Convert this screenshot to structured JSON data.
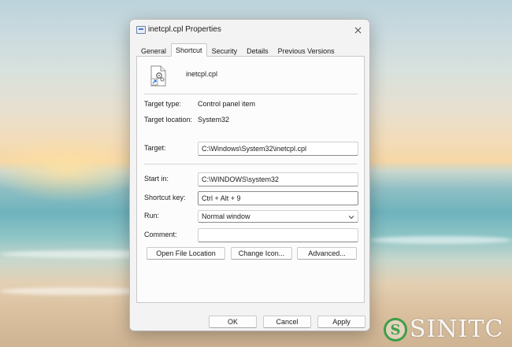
{
  "window": {
    "title": "inetcpl.cpl Properties"
  },
  "tabs": [
    {
      "label": "General"
    },
    {
      "label": "Shortcut"
    },
    {
      "label": "Security"
    },
    {
      "label": "Details"
    },
    {
      "label": "Previous Versions"
    }
  ],
  "active_tab": "Shortcut",
  "shortcut": {
    "file_name": "inetcpl.cpl",
    "target_type_label": "Target type:",
    "target_type_value": "Control panel item",
    "target_location_label": "Target location:",
    "target_location_value": "System32",
    "target_label": "Target:",
    "target_value": "C:\\Windows\\System32\\inetcpl.cpl",
    "start_in_label": "Start in:",
    "start_in_value": "C:\\WINDOWS\\system32",
    "shortcut_key_label": "Shortcut key:",
    "shortcut_key_value": "Ctrl + Alt + 9",
    "run_label": "Run:",
    "run_value": "Normal window",
    "comment_label": "Comment:",
    "comment_value": "",
    "open_file_location_label": "Open File Location",
    "change_icon_label": "Change Icon...",
    "advanced_label": "Advanced..."
  },
  "footer": {
    "ok_label": "OK",
    "cancel_label": "Cancel",
    "apply_label": "Apply"
  },
  "watermark": {
    "letter": "S",
    "text": "SINITC"
  },
  "colors": {
    "dialog_bg": "#f3f3f3",
    "panel_bg": "#fcfcfc",
    "watermark_green": "#3e9f4a"
  },
  "icons": {
    "title": "shortcut-window-icon",
    "close": "close-icon",
    "file": "control-panel-file-icon",
    "run_dropdown": "chevron-down-icon"
  }
}
